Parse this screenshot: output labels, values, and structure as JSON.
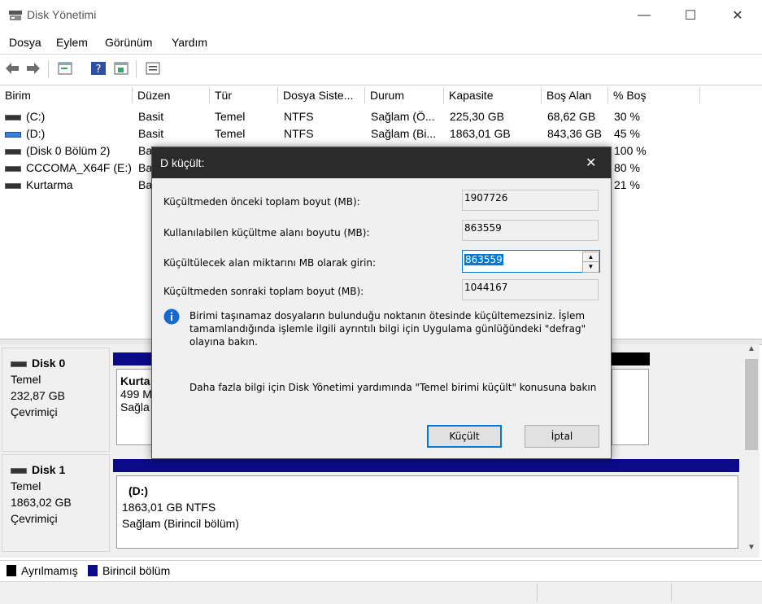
{
  "window": {
    "title": "Disk Yönetimi",
    "minimize": "—",
    "maximize": "☐",
    "close": "✕"
  },
  "menu": [
    "Dosya",
    "Eylem",
    "Görünüm",
    "Yardım"
  ],
  "columns": [
    "Birim",
    "Düzen",
    "Tür",
    "Dosya Siste...",
    "Durum",
    "Kapasite",
    "Boş Alan",
    "% Boş"
  ],
  "volumes": [
    {
      "name": "(C:)",
      "layout": "Basit",
      "type": "Temel",
      "fs": "NTFS",
      "status": "Sağlam (Ö...",
      "capacity": "225,30 GB",
      "free": "68,62 GB",
      "pct": "30 %"
    },
    {
      "name": "(D:)",
      "layout": "Basit",
      "type": "Temel",
      "fs": "NTFS",
      "status": "Sağlam (Bi...",
      "capacity": "1863,01 GB",
      "free": "843,36 GB",
      "pct": "45 %"
    },
    {
      "name": "(Disk 0 Bölüm 2)",
      "layout": "Ba",
      "pct": "100 %"
    },
    {
      "name": "CCCOMA_X64F (E:)",
      "layout": "Ba",
      "pct": "80 %"
    },
    {
      "name": "Kurtarma",
      "layout": "Ba",
      "pct": "21 %"
    }
  ],
  "disks": [
    {
      "name": "Disk 0",
      "type": "Temel",
      "size": "232,87 GB",
      "state": "Çevrimiçi",
      "part_title": "Kurta",
      "part_size": "499 M",
      "part_status": "Sağla"
    },
    {
      "name": "Disk 1",
      "type": "Temel",
      "size": "1863,02 GB",
      "state": "Çevrimiçi",
      "part_title": "(D:)",
      "part_size": "1863,01 GB NTFS",
      "part_status": "Sağlam (Birincil bölüm)"
    }
  ],
  "legend": [
    "Ayrılmamış",
    "Birincil bölüm"
  ],
  "dialog": {
    "title": "D küçült:",
    "close": "✕",
    "fields": [
      {
        "label": "Küçültmeden önceki toplam boyut (MB):",
        "value": "1907726"
      },
      {
        "label": "Kullanılabilen küçültme alanı boyutu (MB):",
        "value": "863559"
      },
      {
        "label": "Küçültülecek alan miktarını MB olarak girin:",
        "value": "863559"
      },
      {
        "label": "Küçültmeden sonraki toplam boyut (MB):",
        "value": "1044167"
      }
    ],
    "info": "Birimi taşınamaz dosyaların bulunduğu noktanın ötesinde küçültemezsiniz. İşlem tamamlandığında işlemle ilgili ayrıntılı bilgi için Uygulama günlüğündeki \"defrag\" olayına bakın.",
    "help": "Daha fazla bilgi için Disk Yönetimi yardımında \"Temel birimi küçült\" konusuna bakın",
    "ok": "Küçült",
    "cancel": "İptal"
  },
  "colors": {
    "primary_partition": "#0b0b8a",
    "unallocated": "#000000",
    "dialog_title_bg": "#2b2b2b"
  }
}
